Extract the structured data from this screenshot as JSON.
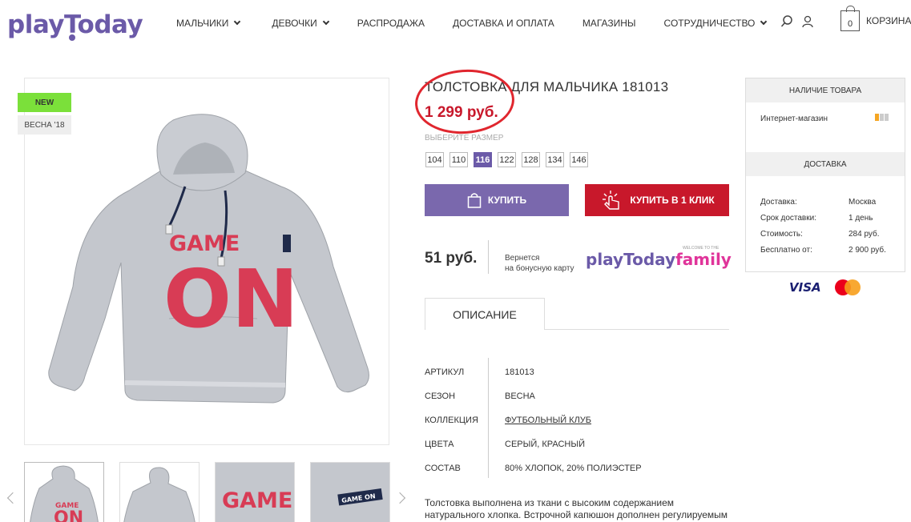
{
  "header": {
    "logo": "playToday",
    "nav": [
      {
        "label": "МАЛЬЧИКИ",
        "dropdown": true
      },
      {
        "label": "ДЕВОЧКИ",
        "dropdown": true
      },
      {
        "label": "РАСПРОДАЖА",
        "dropdown": false
      },
      {
        "label": "ДОСТАВКА И ОПЛАТА",
        "dropdown": false
      },
      {
        "label": "МАГАЗИНЫ",
        "dropdown": false
      },
      {
        "label": "СОТРУДНИЧЕСТВО",
        "dropdown": true
      }
    ],
    "cart_count": "0",
    "cart_label": "КОРЗИНА"
  },
  "gallery": {
    "badge_new": "NEW",
    "badge_season": "ВЕСНА '18",
    "print_line1": "GAME",
    "print_line2": "ON",
    "thumb_tag": "GAME ON"
  },
  "product": {
    "title": "ТОЛСТОВКА ДЛЯ МАЛЬЧИКА 181013",
    "price": "1 299 руб.",
    "size_label": "ВЫБЕРИТЕ РАЗМЕР",
    "sizes": [
      "104",
      "110",
      "116",
      "122",
      "128",
      "134",
      "146"
    ],
    "selected_size": "116",
    "buy_label": "КУПИТЬ",
    "one_click_label": "КУПИТЬ В 1 КЛИК",
    "bonus_value": "51 руб.",
    "bonus_text_1": "Вернется",
    "bonus_text_2": "на бонусную карту",
    "family_logo_main": "playToday",
    "family_logo_accent": "family",
    "family_welcome": "WELCOME TO THE",
    "tab_description": "ОПИСАНИЕ",
    "specs": [
      {
        "key": "АРТИКУЛ",
        "value": "181013",
        "link": false
      },
      {
        "key": "СЕЗОН",
        "value": "ВЕСНА",
        "link": false
      },
      {
        "key": "КОЛЛЕКЦИЯ",
        "value": "ФУТБОЛЬНЫЙ КЛУБ",
        "link": true
      },
      {
        "key": "ЦВЕТА",
        "value": "СЕРЫЙ, КРАСНЫЙ",
        "link": false
      },
      {
        "key": "СОСТАВ",
        "value": "80% ХЛОПОК, 20% ПОЛИЭСТЕР",
        "link": false
      }
    ],
    "description": "Толстовка выполнена из ткани с высоким содержанием натурального хлопка. Встрочной капюшон дополнен регулируемым шнуром -"
  },
  "availability": {
    "header": "НАЛИЧИЕ ТОВАРА",
    "store_label": "Интернет-магазин",
    "stock_colors": [
      "#f5a623",
      "#cccccc",
      "#cccccc"
    ],
    "delivery_header": "ДОСТАВКА",
    "delivery": [
      {
        "key": "Доставка:",
        "value": "Москва"
      },
      {
        "key": "Срок доставки:",
        "value": "1 день"
      },
      {
        "key": "Стоимость:",
        "value": "284 руб."
      },
      {
        "key": "Бесплатно от:",
        "value": "2 900 руб."
      }
    ]
  },
  "payments": {
    "visa": "VISA"
  },
  "colors": {
    "brand_purple": "#6b5aa8",
    "buy_red": "#c8182b",
    "new_green": "#7be03a"
  }
}
